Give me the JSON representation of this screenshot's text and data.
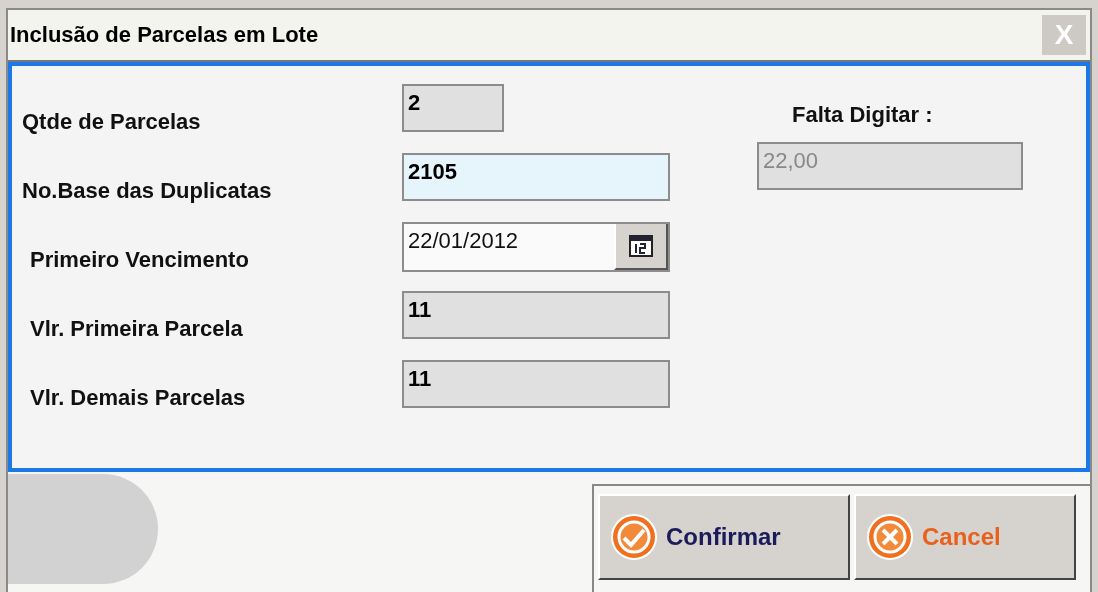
{
  "window": {
    "title": "Inclusão de Parcelas em Lote",
    "close": "X"
  },
  "fields": [
    {
      "label": "Qtde de Parcelas",
      "value": "2",
      "kind": "readonly"
    },
    {
      "label": "No.Base das Duplicatas",
      "value": "2105",
      "kind": "input"
    },
    {
      "label": "Primeiro Vencimento",
      "value": "22/01/2012",
      "kind": "date"
    },
    {
      "label": "Vlr. Primeira Parcela",
      "value": "11",
      "kind": "readonly"
    },
    {
      "label": "Vlr. Demais Parcelas",
      "value": "11",
      "kind": "readonly"
    }
  ],
  "remaining": {
    "label": "Falta Digitar :",
    "value": "22,00",
    "kind": "disabled"
  },
  "buttons": [
    {
      "label": "Confirmar",
      "kind": "confirm"
    },
    {
      "label": "Cancel",
      "kind": "cancel"
    }
  ]
}
